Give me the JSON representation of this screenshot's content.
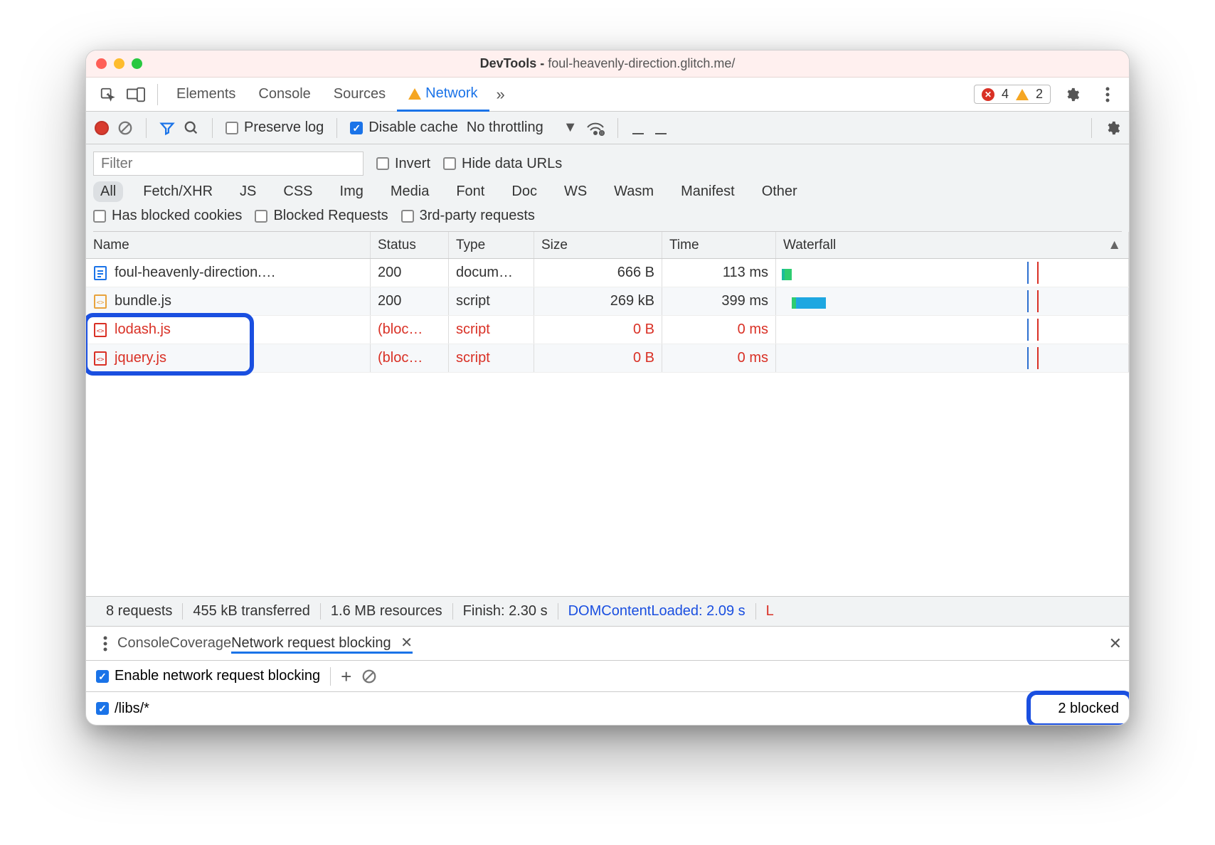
{
  "window": {
    "title_prefix": "DevTools - ",
    "title_url": "foul-heavenly-direction.glitch.me/"
  },
  "tabs": {
    "items": [
      "Elements",
      "Console",
      "Sources",
      "Network"
    ],
    "active_index": 3,
    "more_glyph": "»",
    "error_count": "4",
    "warning_count": "2"
  },
  "toolbar": {
    "preserve_log_label": "Preserve log",
    "preserve_log_checked": false,
    "disable_cache_label": "Disable cache",
    "disable_cache_checked": true,
    "throttling_label": "No throttling"
  },
  "filter": {
    "placeholder": "Filter",
    "invert_label": "Invert",
    "hide_data_urls_label": "Hide data URLs",
    "types": [
      "All",
      "Fetch/XHR",
      "JS",
      "CSS",
      "Img",
      "Media",
      "Font",
      "Doc",
      "WS",
      "Wasm",
      "Manifest",
      "Other"
    ],
    "active_type_index": 0,
    "has_blocked_cookies_label": "Has blocked cookies",
    "blocked_requests_label": "Blocked Requests",
    "third_party_label": "3rd-party requests"
  },
  "columns": {
    "name": "Name",
    "status": "Status",
    "type": "Type",
    "size": "Size",
    "time": "Time",
    "waterfall": "Waterfall"
  },
  "rows": [
    {
      "name": "foul-heavenly-direction.…",
      "status": "200",
      "type": "docum…",
      "size": "666 B",
      "time": "113 ms",
      "blocked": false,
      "icon": "doc"
    },
    {
      "name": "bundle.js",
      "status": "200",
      "type": "script",
      "size": "269 kB",
      "time": "399 ms",
      "blocked": false,
      "icon": "js"
    },
    {
      "name": "lodash.js",
      "status": "(bloc…",
      "type": "script",
      "size": "0 B",
      "time": "0 ms",
      "blocked": true,
      "icon": "js"
    },
    {
      "name": "jquery.js",
      "status": "(bloc…",
      "type": "script",
      "size": "0 B",
      "time": "0 ms",
      "blocked": true,
      "icon": "js"
    }
  ],
  "summary": {
    "requests": "8 requests",
    "transferred": "455 kB transferred",
    "resources": "1.6 MB resources",
    "finish": "Finish: 2.30 s",
    "dcl": "DOMContentLoaded: 2.09 s",
    "load": "L"
  },
  "drawer": {
    "tabs": [
      "Console",
      "Coverage",
      "Network request blocking"
    ],
    "active_index": 2,
    "enable_label": "Enable network request blocking",
    "enable_checked": true,
    "patterns": [
      {
        "pattern": "/libs/*",
        "checked": true,
        "count_label": "2 blocked"
      }
    ]
  }
}
